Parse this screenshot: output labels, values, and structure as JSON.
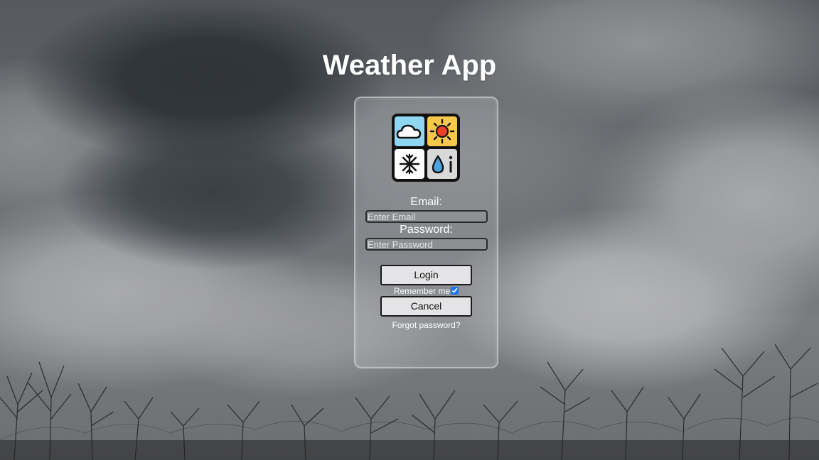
{
  "app": {
    "title": "Weather App"
  },
  "logo": {
    "icon": "weather-logo-icon",
    "tiles": [
      "cloud-icon",
      "sun-icon",
      "snowflake-icon",
      "drop-info-icon"
    ]
  },
  "form": {
    "email_label": "Email:",
    "email_placeholder": "Enter Email",
    "email_value": "",
    "password_label": "Password:",
    "password_placeholder": "Enter Password",
    "password_value": "",
    "login_label": "Login",
    "remember_label": "Remember me",
    "remember_checked": true,
    "cancel_label": "Cancel",
    "forgot_label": "Forgot password?"
  },
  "colors": {
    "tile_cloud": "#8fd6f3",
    "tile_sun": "#f8c84c",
    "tile_snow": "#ffffff",
    "tile_drop": "#d9d9d9",
    "sun_core": "#e8402b",
    "drop_fill": "#4aa3df",
    "checkbox_accent": "#1a73e8"
  }
}
